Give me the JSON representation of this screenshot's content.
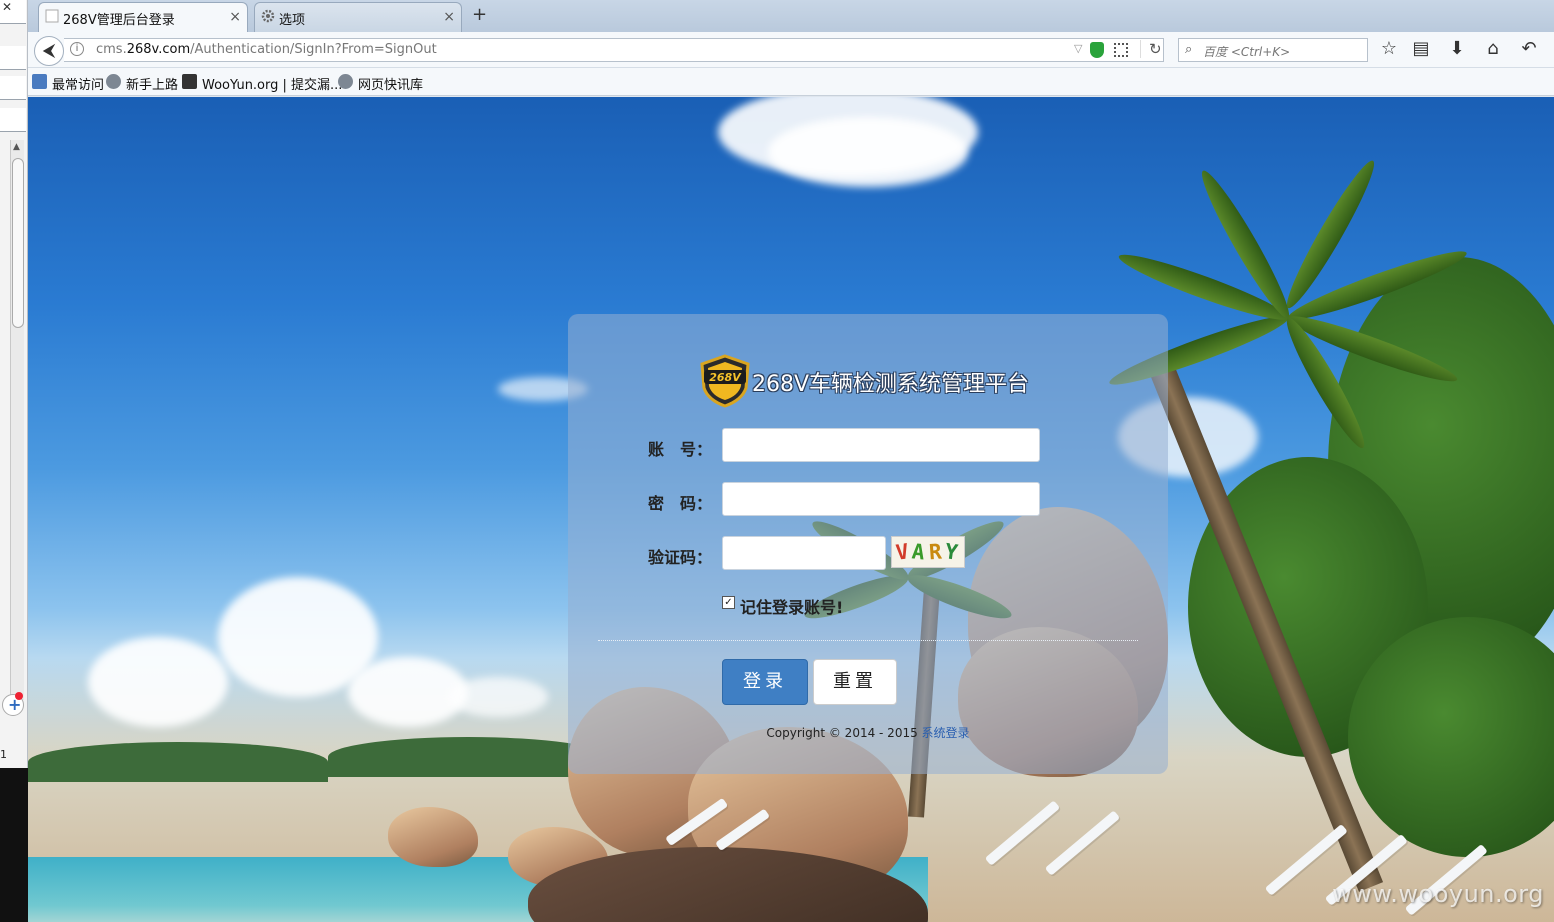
{
  "browser": {
    "tabs": [
      {
        "label": "268V管理后台登录",
        "active": true
      },
      {
        "label": "选项",
        "active": false
      }
    ],
    "new_tab_symbol": "+",
    "close_symbol": "×",
    "url_prefix": "cms.",
    "url_domain": "268v.com",
    "url_path": "/Authentication/SignIn?From=SignOut",
    "search_placeholder": "百度 <Ctrl+K>",
    "bookmarks": [
      "最常访问",
      "新手上路",
      "WooYun.org | 提交漏...",
      "网页快讯库"
    ],
    "icons": {
      "back": "back-arrow-icon",
      "info": "info-icon",
      "reload": "reload-icon",
      "search": "search-icon",
      "star": "star-icon",
      "clipboard": "reading-list-icon",
      "download": "download-icon",
      "home": "home-icon",
      "undo": "undo-icon"
    }
  },
  "login": {
    "title": "268V车辆检测系统管理平台",
    "logo_text": "268V",
    "account_label": "账　号：",
    "password_label": "密　码：",
    "captcha_label": "验证码：",
    "captcha_chars": [
      "V",
      "A",
      "R",
      "Y"
    ],
    "remember_label": "记住登录账号!",
    "remember_checked": true,
    "login_button": "登录",
    "reset_button": "重置",
    "copyright_text": "Copyright © 2014 - 2015 ",
    "copyright_link": "系统登录"
  },
  "watermark": "www.wooyun.org",
  "colors": {
    "login_button": "#3f7fc4",
    "panel": "rgba(150,175,210,0.55)",
    "link": "#2a5fb0"
  }
}
